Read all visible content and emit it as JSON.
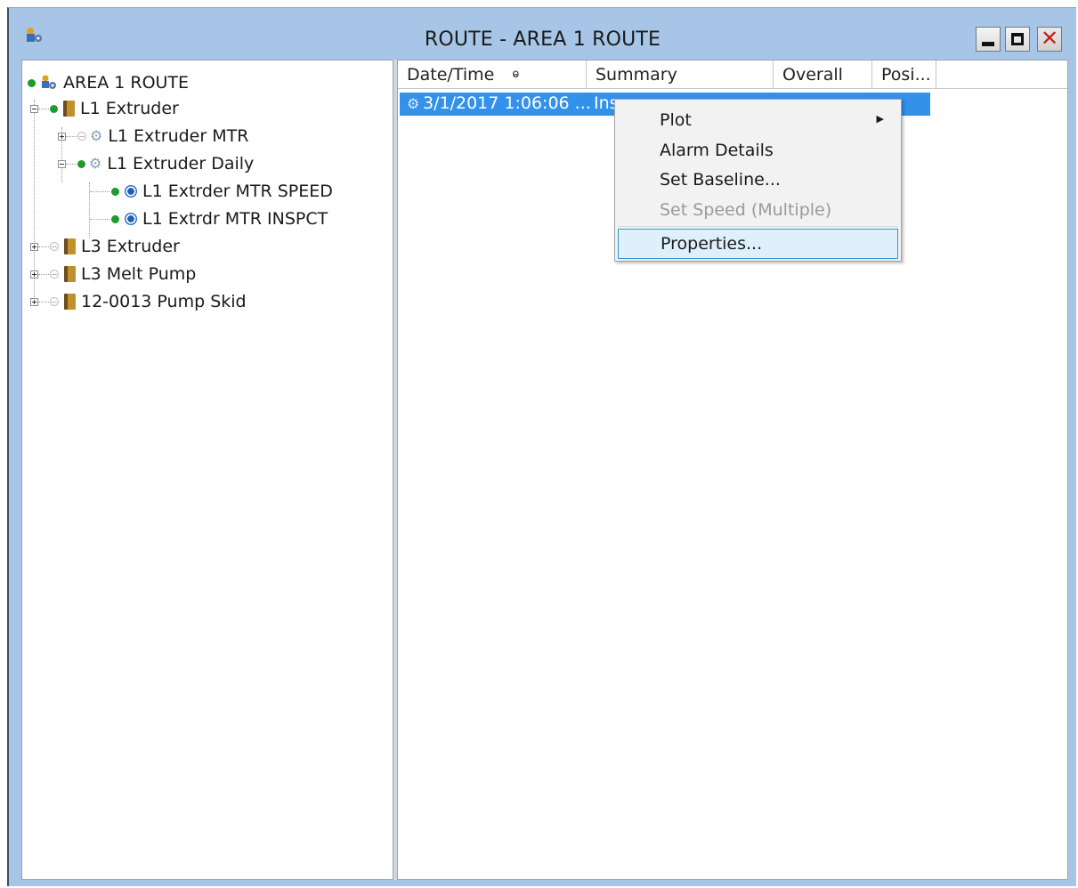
{
  "window": {
    "title": "ROUTE - AREA 1 ROUTE",
    "icon": "route-icon",
    "controls": {
      "minimize": "minimize-icon",
      "maximize": "maximize-icon",
      "close": "✕"
    }
  },
  "tree": {
    "root": {
      "label": "AREA 1 ROUTE",
      "status": "green"
    },
    "nodes": [
      {
        "label": "L1 Extruder",
        "status": "green",
        "expanded": true
      },
      {
        "label": "L1 Extruder MTR",
        "status": "gray",
        "expanded": false
      },
      {
        "label": "L1 Extruder Daily",
        "status": "green",
        "expanded": true
      },
      {
        "label": "L1 Extrder MTR SPEED",
        "status": "green"
      },
      {
        "label": "L1 Extrdr MTR INSPCT",
        "status": "green"
      },
      {
        "label": "L3 Extruder",
        "status": "gray",
        "expanded": false
      },
      {
        "label": "L3 Melt Pump",
        "status": "gray",
        "expanded": false
      },
      {
        "label": "12-0013 Pump Skid",
        "status": "gray",
        "expanded": false
      }
    ]
  },
  "list": {
    "columns": [
      {
        "label": "Date/Time",
        "sort": "ⱺ"
      },
      {
        "label": "Summary"
      },
      {
        "label": "Overall"
      },
      {
        "label": "Posi..."
      }
    ],
    "rows": [
      {
        "date": "3/1/2017 1:06:06 ...",
        "summary": "Ins",
        "overall": "",
        "position": ""
      }
    ]
  },
  "context_menu": {
    "items": [
      {
        "label": "Plot",
        "submenu": true,
        "enabled": true
      },
      {
        "label": "Alarm Details",
        "enabled": true
      },
      {
        "label": "Set Baseline...",
        "enabled": true
      },
      {
        "label": "Set Speed (Multiple)",
        "enabled": false
      },
      {
        "label": "Properties...",
        "enabled": true,
        "highlighted": true
      }
    ]
  },
  "colors": {
    "title_bar": "#a7c5e6",
    "selection": "#3391ea",
    "status_ok": "#1d9b2c",
    "menu_hot": "#dff0fb"
  }
}
